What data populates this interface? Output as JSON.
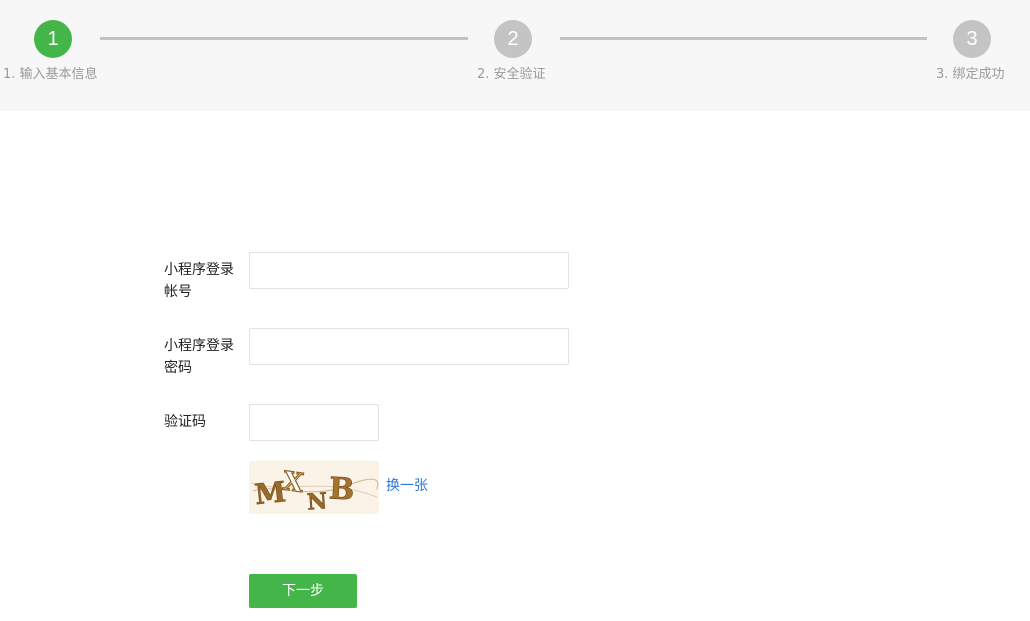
{
  "stepper": {
    "steps": [
      {
        "number": "1",
        "label": "1. 输入基本信息",
        "state": "active"
      },
      {
        "number": "2",
        "label": "2. 安全验证",
        "state": "inactive"
      },
      {
        "number": "3",
        "label": "3. 绑定成功",
        "state": "inactive"
      }
    ],
    "active_color": "#44b549",
    "inactive_color": "#c4c4c4"
  },
  "form": {
    "account": {
      "label": "小程序登录帐号",
      "value": "",
      "placeholder": ""
    },
    "password": {
      "label": "小程序登录密码",
      "value": "",
      "placeholder": ""
    },
    "verify_code": {
      "label": "验证码",
      "value": "",
      "placeholder": ""
    },
    "captcha": {
      "text": "MXNB"
    },
    "refresh_label": "换一张",
    "next_label": "下一步"
  },
  "colors": {
    "primary": "#44b549",
    "link": "#2f78d6",
    "captcha_text": "#9a6a28"
  }
}
